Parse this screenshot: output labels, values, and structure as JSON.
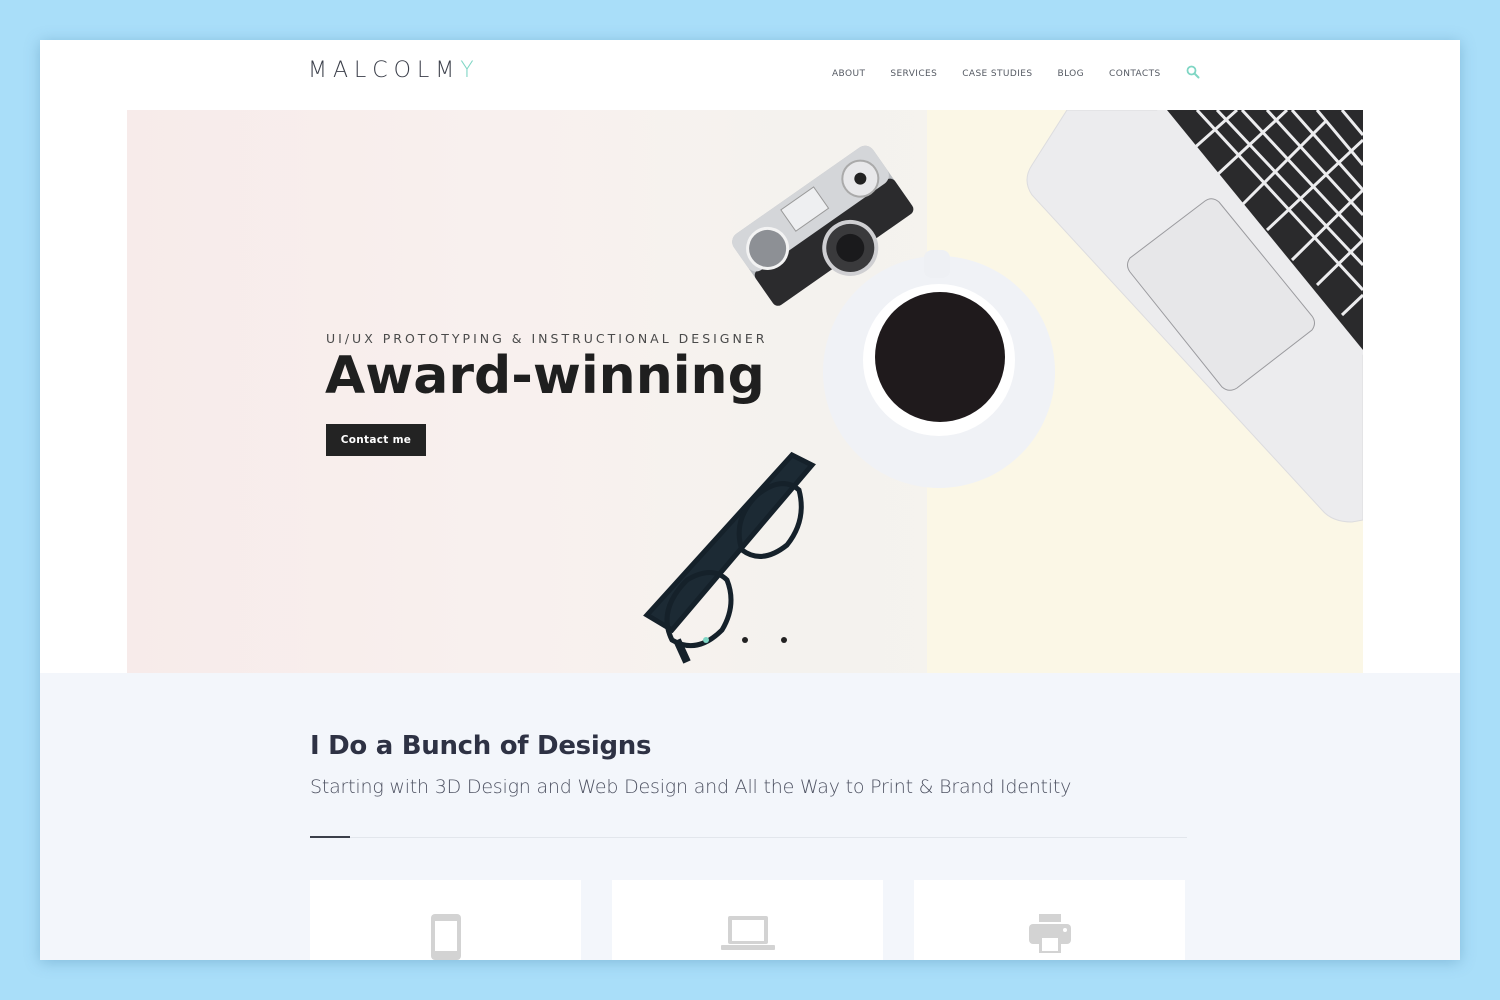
{
  "brand": {
    "logo_main": "MALCOLM",
    "logo_accent": "Y",
    "accent_color": "#7fd6c4"
  },
  "nav": {
    "items": [
      {
        "label": "ABOUT"
      },
      {
        "label": "SERVICES"
      },
      {
        "label": "CASE STUDIES"
      },
      {
        "label": "BLOG"
      },
      {
        "label": "CONTACTS"
      }
    ],
    "search_icon": "search-icon"
  },
  "hero": {
    "subtitle": "UI/UX PROTOTYPING & INSTRUCTIONAL DESIGNER",
    "title": "Award-winning",
    "cta_label": "Contact me",
    "slides": {
      "count": 3,
      "active": 1
    }
  },
  "services": {
    "heading": "I Do a Bunch of Designs",
    "lead": "Starting with 3D Design and Web Design and All the Way to Print & Brand Identity",
    "cards": [
      {
        "icon": "mobile-icon"
      },
      {
        "icon": "laptop-icon"
      },
      {
        "icon": "printer-icon"
      }
    ]
  }
}
